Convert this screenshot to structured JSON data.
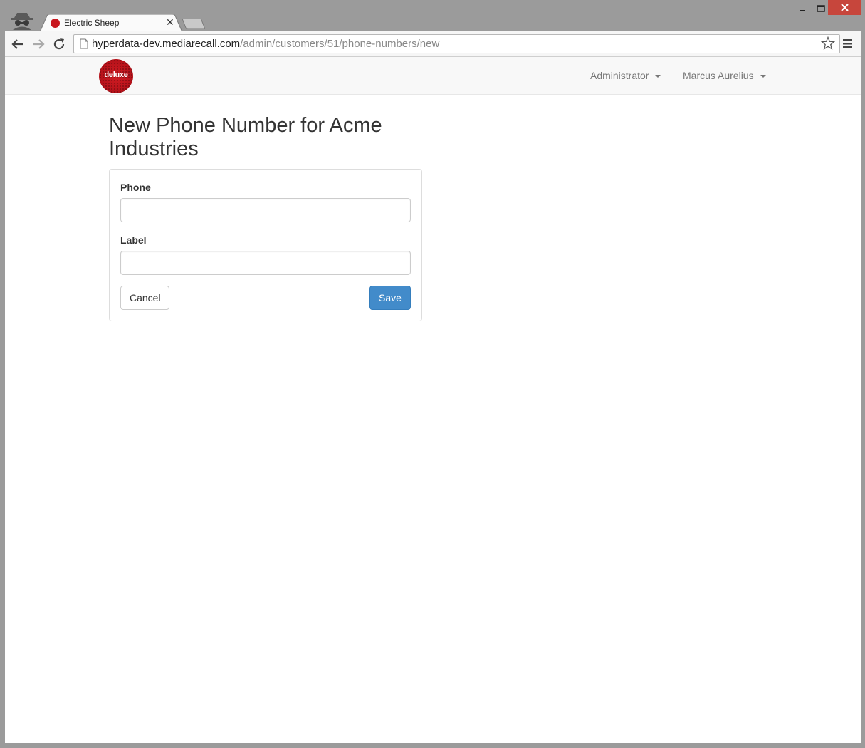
{
  "browser": {
    "tab_title": "Electric Sheep",
    "tab_close": "✕",
    "url_host": "hyperdata-dev.mediarecall.com",
    "url_path": "/admin/customers/51/phone-numbers/new"
  },
  "navbar": {
    "brand_text": "deluxe",
    "items": [
      {
        "label": "Administrator"
      },
      {
        "label": "Marcus Aurelius"
      }
    ]
  },
  "page": {
    "title": "New Phone Number for Acme Industries"
  },
  "form": {
    "phone_label": "Phone",
    "phone_value": "",
    "label_label": "Label",
    "label_value": "",
    "cancel_label": "Cancel",
    "save_label": "Save"
  },
  "colors": {
    "primary": "#428bca",
    "brand": "#c8161d",
    "window_close": "#c7463c"
  }
}
